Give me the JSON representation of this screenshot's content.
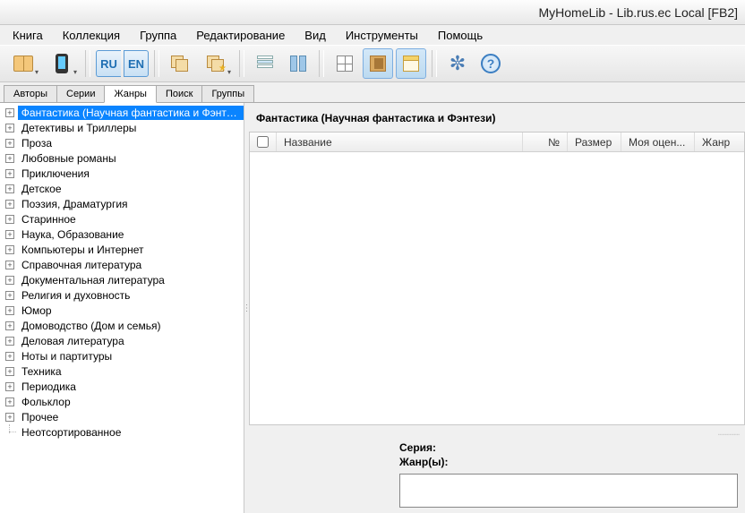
{
  "title": "MyHomeLib - Lib.rus.ec Local [FB2]",
  "menu": [
    "Книга",
    "Коллекция",
    "Группа",
    "Редактирование",
    "Вид",
    "Инструменты",
    "Помощь"
  ],
  "lang": {
    "ru": "RU",
    "en": "EN"
  },
  "tabs": [
    "Авторы",
    "Серии",
    "Жанры",
    "Поиск",
    "Группы"
  ],
  "active_tab": 2,
  "tree": [
    {
      "label": "Фантастика (Научная фантастика и Фэнтези)",
      "selected": true,
      "expandable": true
    },
    {
      "label": "Детективы и Триллеры",
      "expandable": true
    },
    {
      "label": "Проза",
      "expandable": true
    },
    {
      "label": "Любовные романы",
      "expandable": true
    },
    {
      "label": "Приключения",
      "expandable": true
    },
    {
      "label": "Детское",
      "expandable": true
    },
    {
      "label": "Поэзия, Драматургия",
      "expandable": true
    },
    {
      "label": "Старинное",
      "expandable": true
    },
    {
      "label": "Наука, Образование",
      "expandable": true
    },
    {
      "label": "Компьютеры и Интернет",
      "expandable": true
    },
    {
      "label": "Справочная литература",
      "expandable": true
    },
    {
      "label": "Документальная литература",
      "expandable": true
    },
    {
      "label": "Религия и духовность",
      "expandable": true
    },
    {
      "label": "Юмор",
      "expandable": true
    },
    {
      "label": "Домоводство (Дом и семья)",
      "expandable": true
    },
    {
      "label": "Деловая литература",
      "expandable": true
    },
    {
      "label": "Ноты и партитуры",
      "expandable": true
    },
    {
      "label": "Техника",
      "expandable": true
    },
    {
      "label": "Периодика",
      "expandable": true
    },
    {
      "label": "Фольклор",
      "expandable": true
    },
    {
      "label": "Прочее",
      "expandable": true
    },
    {
      "label": "Неотсортированное",
      "expandable": false
    }
  ],
  "content_header": "Фантастика (Научная фантастика и Фэнтези)",
  "grid_columns": {
    "name": "Название",
    "num": "№",
    "size": "Размер",
    "rating": "Моя оцен...",
    "genre": "Жанр"
  },
  "detail": {
    "series_label": "Серия:",
    "series_value": "",
    "genres_label": "Жанр(ы):",
    "genres_value": ""
  }
}
